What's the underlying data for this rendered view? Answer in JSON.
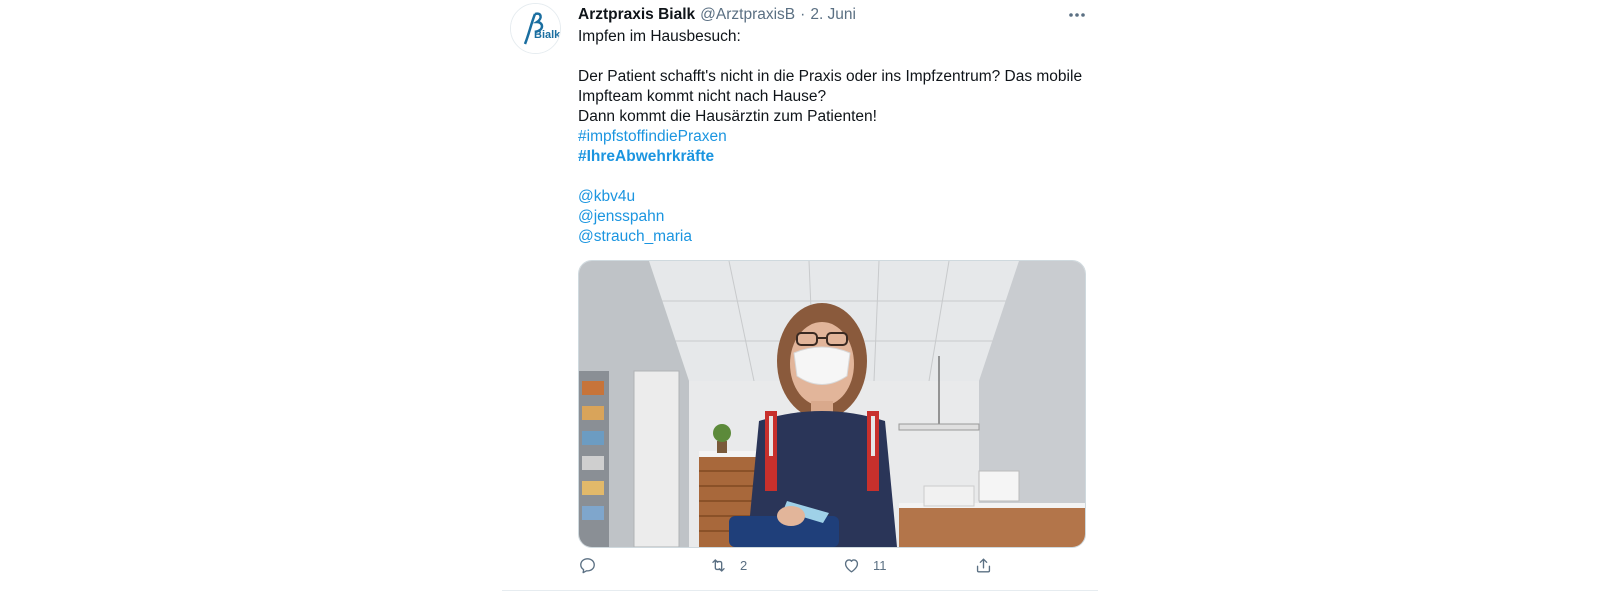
{
  "tweet": {
    "author_name": "Arztpraxis Bialk",
    "author_handle": "@ArztpraxisB",
    "separator": "·",
    "date": "2. Juni",
    "avatar_text": "Bialk",
    "body_lines": [
      "Impfen im Hausbesuch:",
      "",
      "Der Patient schafft's nicht in die Praxis oder ins Impfzentrum? Das mobile",
      "Impfteam kommt nicht nach Hause?",
      "Dann kommt die Hausärztin zum Patienten!"
    ],
    "hashtags": [
      "#impfstoffindiePraxen",
      "#IhreAbwehrkräfte"
    ],
    "mentions": [
      "@kbv4u",
      "@jensspahn",
      "@strauch_maria"
    ],
    "media_description": "",
    "actions": {
      "reply_count": "",
      "retweet_count": "2",
      "like_count": "11"
    }
  },
  "colors": {
    "link": "#1b95e0",
    "secondary_text": "#5b7083",
    "primary_text": "#0f1419",
    "border": "#e6ecf0"
  },
  "icons": {
    "more": "more-horizontal-icon",
    "reply": "reply-icon",
    "retweet": "retweet-icon",
    "like": "heart-icon",
    "share": "share-icon"
  }
}
